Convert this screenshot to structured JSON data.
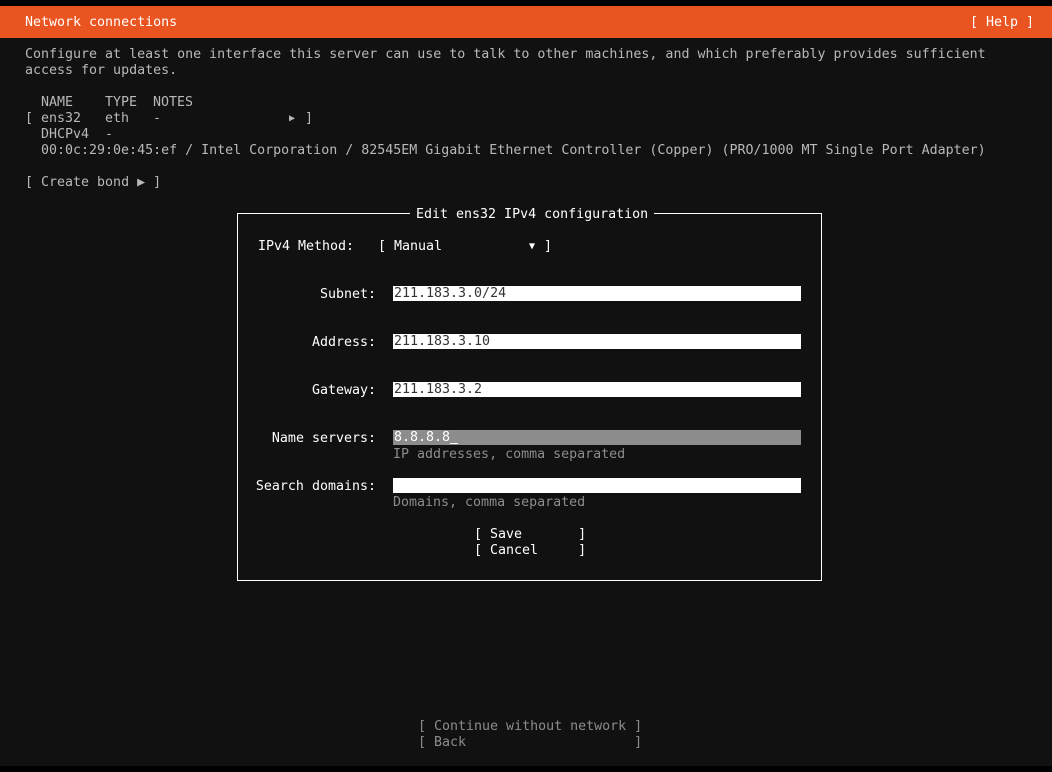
{
  "header": {
    "title": "Network connections",
    "help_label": "[ Help ]",
    "color": "#e95420"
  },
  "intro": {
    "line1": "Configure at least one interface this server can use to talk to other machines, and which preferably provides sufficient",
    "line2": "access for updates."
  },
  "interfaces_table": {
    "columns": [
      "NAME",
      "TYPE",
      "NOTES"
    ],
    "rows": [
      {
        "bracket_open": "[",
        "name": "ens32",
        "type": "eth",
        "notes": "-",
        "arrow_icon": "▶",
        "bracket_close": "]",
        "config": "DHCPv4",
        "config_value": "-",
        "details": "00:0c:29:0e:45:ef / Intel Corporation / 82545EM Gigabit Ethernet Controller (Copper) (PRO/1000 MT Single Port Adapter)"
      }
    ]
  },
  "create_bond_label": "[ Create bond ▶ ]",
  "dialog": {
    "title": "Edit ens32 IPv4 configuration",
    "method_label": "IPv4 Method:",
    "method_open": "[",
    "method_value": "Manual",
    "method_arrow": "▼",
    "method_close": "]",
    "subnet_label": "Subnet:",
    "subnet_value": "211.183.3.0/24",
    "address_label": "Address:",
    "address_value": "211.183.3.10",
    "gateway_label": "Gateway:",
    "gateway_value": "211.183.3.2",
    "nameservers_label": "Name servers:",
    "nameservers_value": "8.8.8.8",
    "nameservers_help": "IP addresses, comma separated",
    "search_label": "Search domains:",
    "search_value": "",
    "search_help": "Domains, comma separated",
    "save_label": "[ Save       ]",
    "cancel_label": "[ Cancel     ]"
  },
  "footer": {
    "continue_label": "[ Continue without network ]",
    "back_label": "[ Back                     ]"
  }
}
